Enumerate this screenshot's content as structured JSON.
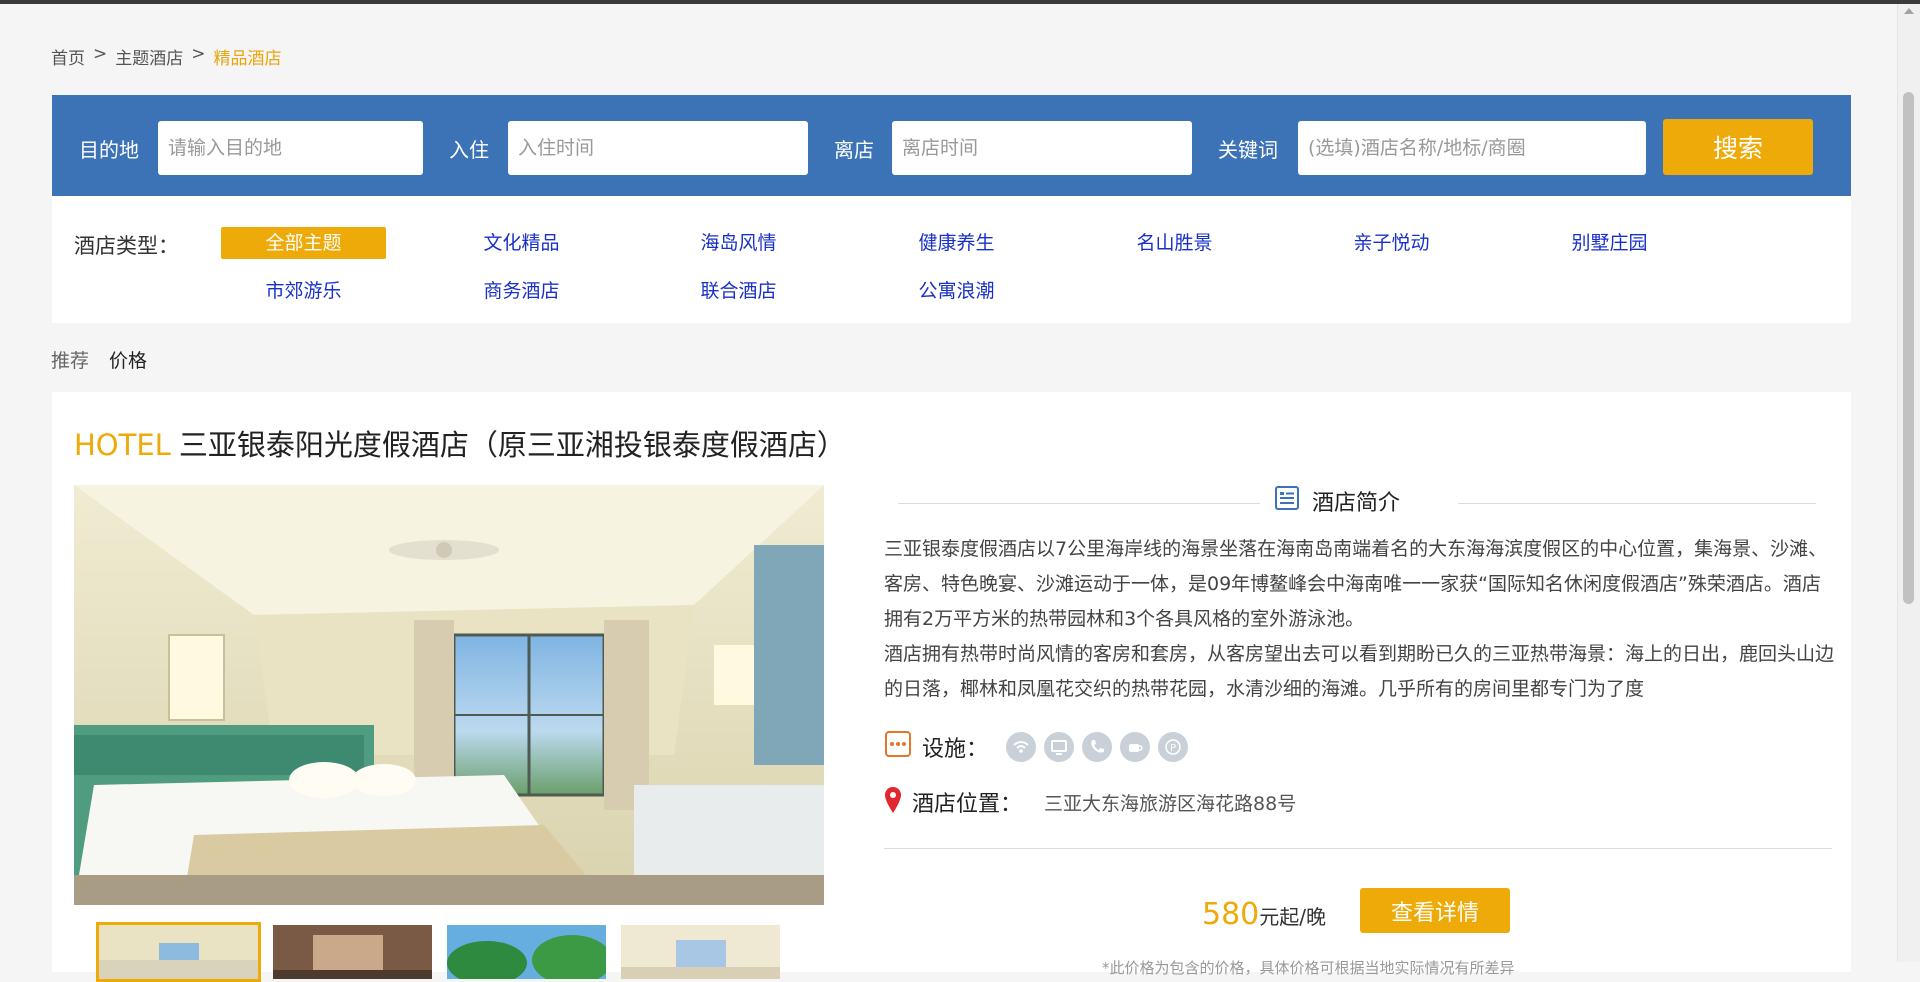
{
  "breadcrumb": {
    "items": [
      "首页",
      "主题酒店"
    ],
    "current": "精品酒店",
    "separator": ">"
  },
  "search": {
    "dest_label": "目的地",
    "dest_placeholder": "请输入目的地",
    "checkin_label": "入住",
    "checkin_placeholder": "入住时间",
    "checkout_label": "离店",
    "checkout_placeholder": "离店时间",
    "keyword_label": "关键词",
    "keyword_placeholder": "(选填)酒店名称/地标/商圈",
    "button": "搜索"
  },
  "hotel_types": {
    "label": "酒店类型：",
    "items": [
      "全部主题",
      "文化精品",
      "海岛风情",
      "健康养生",
      "名山胜景",
      "亲子悦动",
      "别墅庄园",
      "市郊游乐",
      "商务酒店",
      "联合酒店",
      "公寓浪潮"
    ],
    "active": "全部主题"
  },
  "sort": {
    "recommend": "推荐",
    "price": "价格"
  },
  "hotel": {
    "tag": "HOTEL",
    "name": "三亚银泰阳光度假酒店（原三亚湘投银泰度假酒店）",
    "intro_title": "酒店简介",
    "intro_p1": "三亚银泰度假酒店以7公里海岸线的海景坐落在海南岛南端着名的大东海海滨度假区的中心位置，集海景、沙滩、客房、特色晚宴、沙滩运动于一体，是09年博鳌峰会中海南唯一一家获“国际知名休闲度假酒店”殊荣酒店。酒店拥有2万平方米的热带园林和3个各具风格的室外游泳池。",
    "intro_p2": "酒店拥有热带时尚风情的客房和套房，从客房望出去可以看到期盼已久的三亚热带海景：海上的日出，鹿回头山边的日落，椰林和凤凰花交织的热带花园，水清沙细的海滩。几乎所有的房间里都专门为了度",
    "facility_label": "设施：",
    "facilities": [
      "wifi-icon",
      "tv-icon",
      "phone-icon",
      "breakfast-icon",
      "parking-icon"
    ],
    "location_label": "酒店位置：",
    "address": "三亚大东海旅游区海花路88号",
    "price": "580",
    "price_unit": "元起/晚",
    "detail_button": "查看详情",
    "note": "*此价格为包含的价格，具体价格可根据当地实际情况有所差异"
  },
  "colors": {
    "accent": "#eeaa08",
    "search_bar": "#3c72b6",
    "link": "#1a31c8"
  }
}
